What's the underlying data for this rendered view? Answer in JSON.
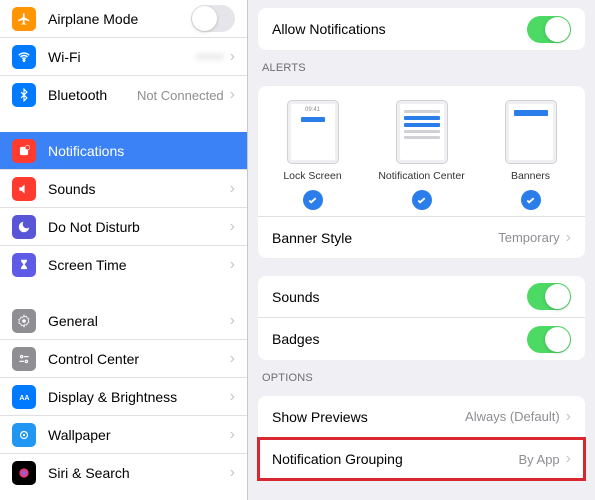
{
  "sidebar": {
    "group1": [
      {
        "label": "Airplane Mode",
        "value": ""
      },
      {
        "label": "Wi-Fi",
        "value": "••••••"
      },
      {
        "label": "Bluetooth",
        "value": "Not Connected"
      }
    ],
    "group2": [
      {
        "label": "Notifications"
      },
      {
        "label": "Sounds"
      },
      {
        "label": "Do Not Disturb"
      },
      {
        "label": "Screen Time"
      }
    ],
    "group3": [
      {
        "label": "General"
      },
      {
        "label": "Control Center"
      },
      {
        "label": "Display & Brightness"
      },
      {
        "label": "Wallpaper"
      },
      {
        "label": "Siri & Search"
      }
    ]
  },
  "main": {
    "allow": {
      "label": "Allow Notifications"
    },
    "alerts_header": "Alerts",
    "alerts": {
      "lock": {
        "label": "Lock Screen",
        "time": "09:41"
      },
      "center": {
        "label": "Notification Center"
      },
      "banners": {
        "label": "Banners"
      }
    },
    "banner_style": {
      "label": "Banner Style",
      "value": "Temporary"
    },
    "sounds": {
      "label": "Sounds"
    },
    "badges": {
      "label": "Badges"
    },
    "options_header": "Options",
    "previews": {
      "label": "Show Previews",
      "value": "Always (Default)"
    },
    "grouping": {
      "label": "Notification Grouping",
      "value": "By App"
    }
  }
}
